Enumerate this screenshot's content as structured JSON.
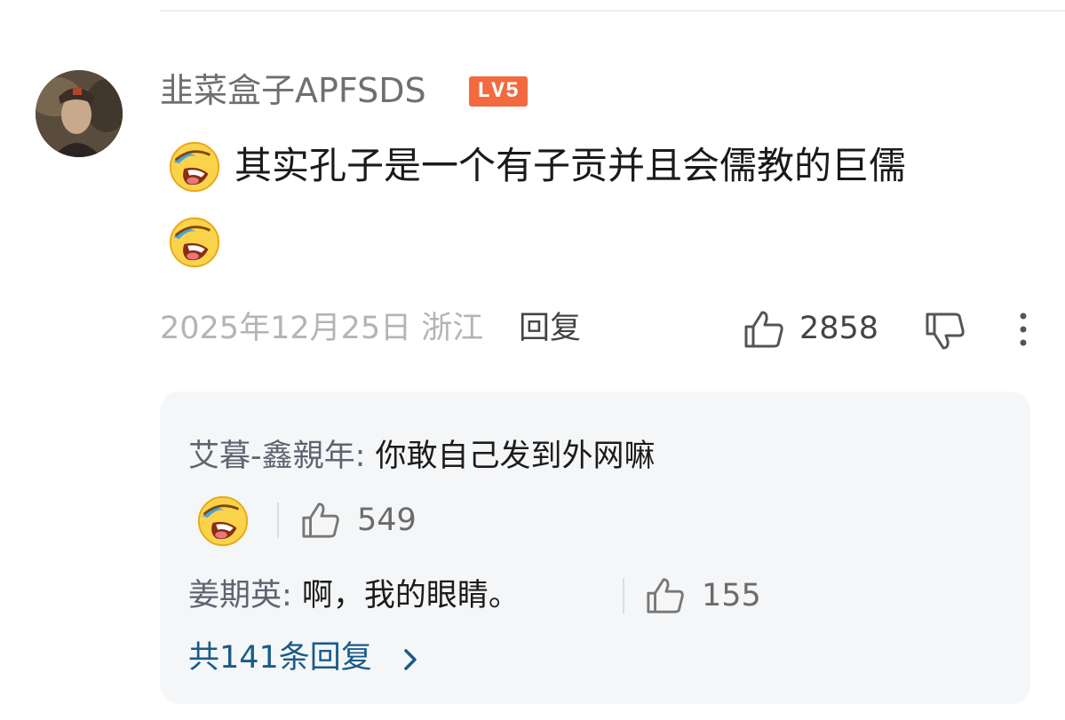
{
  "comment": {
    "username": "韭菜盒子APFSDS",
    "level_badge": "LV5",
    "text": "其实孔子是一个有子贡并且会儒教的巨儒",
    "emoji_icon": "laughing-crying-emoji",
    "date": "2025年12月25日",
    "location": "浙江",
    "reply_label": "回复",
    "likes": "2858"
  },
  "replies": [
    {
      "name": "艾暮-鑫親年:",
      "text": " 你敢自己发到外网嘛",
      "likes": "549"
    },
    {
      "name": "姜期英:",
      "text": " 啊，我的眼睛。",
      "likes": "155"
    }
  ],
  "total_replies_label": "共141条回复",
  "colors": {
    "badge": "#f26a3e",
    "link": "#185c89",
    "reply_bg": "#f5f6f8"
  }
}
